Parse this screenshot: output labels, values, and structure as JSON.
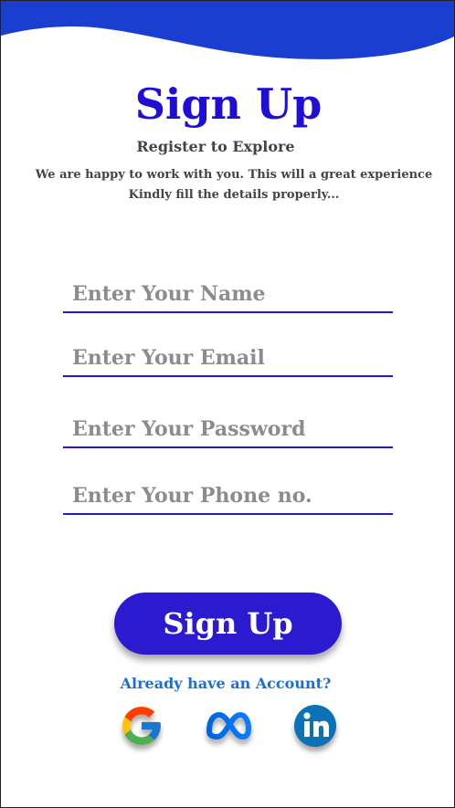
{
  "header": {
    "title": "Sign Up",
    "subtitle": "Register to Explore",
    "description_line1": "We are happy to work with you. This will a great experience",
    "description_line2": "Kindly fill the details properly..."
  },
  "form": {
    "name_placeholder": "Enter Your Name",
    "email_placeholder": "Enter Your Email",
    "password_placeholder": "Enter Your Password",
    "phone_placeholder": "Enter Your Phone no.",
    "submit_label": "Sign Up"
  },
  "footer": {
    "login_link": "Already have an Account?"
  },
  "social": [
    "google-icon",
    "meta-icon",
    "linkedin-icon"
  ],
  "colors": {
    "accent": "#1f0fd6",
    "wave": "#1a3fd0",
    "button": "#2b1ad0",
    "link": "#1a6fd6"
  }
}
